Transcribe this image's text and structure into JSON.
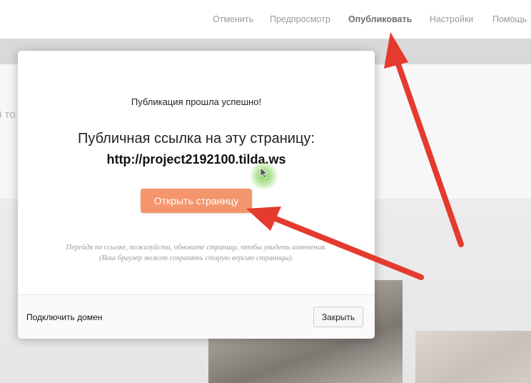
{
  "nav": {
    "cancel": "Отменить",
    "preview": "Предпросмотр",
    "publish": "Опубликовать",
    "settings": "Настройки",
    "help": "Помощь"
  },
  "background": {
    "partial_text": "й то"
  },
  "modal": {
    "success_message": "Публикация прошла успешно!",
    "link_label": "Публичная ссылка на эту страницу:",
    "link_url": "http://project2192100.tilda.ws",
    "open_button": "Открыть страницу",
    "hint_text": "Перейдя по ссылке, пожалуйста, обновите страницу, чтобы увидеть изменения. (Ваш браузер может сохранять старую версию страницы).",
    "connect_domain": "Подключить домен",
    "close_button": "Закрыть"
  },
  "colors": {
    "accent_button": "#f4956b",
    "annotation_arrow": "#e53a2e",
    "cursor_highlight": "#6ec83c"
  },
  "icons": {
    "cursor": "mouse-pointer-icon",
    "annotation": "red-arrow"
  }
}
